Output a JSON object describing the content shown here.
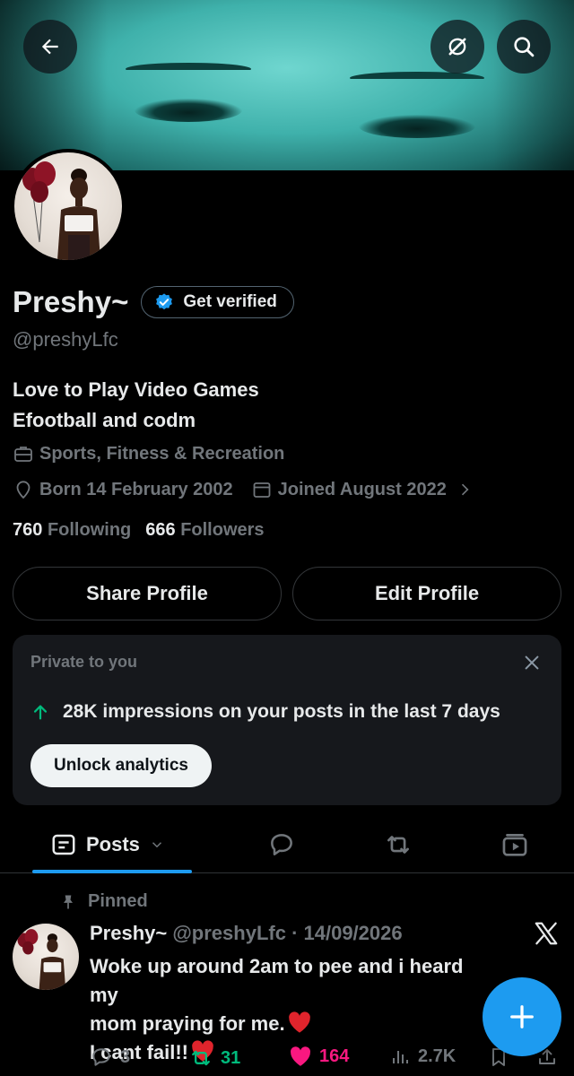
{
  "profile": {
    "name": "Preshy~",
    "get_verified_label": "Get verified",
    "handle": "@preshyLfc",
    "bio_line1": "Love to Play Video Games",
    "bio_line2": "Efootball and codm",
    "category": "Sports, Fitness & Recreation",
    "born": "Born 14 February 2002",
    "joined": "Joined August 2022",
    "following_count": "760",
    "following_label": "Following",
    "followers_count": "666",
    "followers_label": "Followers"
  },
  "buttons": {
    "share_profile": "Share Profile",
    "edit_profile": "Edit Profile"
  },
  "analytics_card": {
    "label": "Private to you",
    "stat": "28K impressions on your posts in the last 7 days",
    "unlock": "Unlock analytics"
  },
  "tabs": {
    "posts_label": "Posts"
  },
  "post": {
    "pinned_label": "Pinned",
    "author": "Preshy~",
    "handle_date": "@preshyLfc · 14/09/2026",
    "line1": "Woke up around 2am to pee and i heard my",
    "line2": "mom praying for me.",
    "line3": "I cant fail!!",
    "replies": "3",
    "reposts": "31",
    "likes": "164",
    "views": "2.7K"
  },
  "colors": {
    "accent": "#1d9bf0",
    "repost_green": "#00ba7c",
    "like_pink": "#f91880",
    "muted": "#71767b"
  }
}
